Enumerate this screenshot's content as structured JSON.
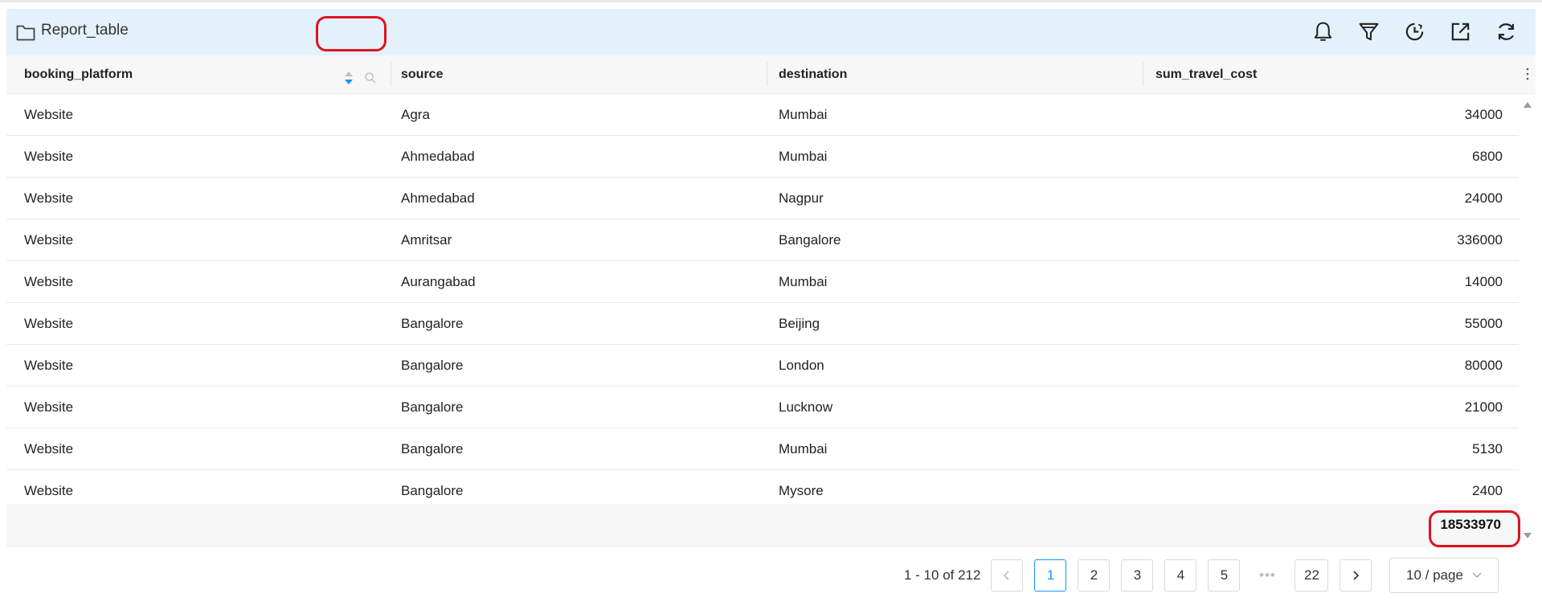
{
  "title": "Report_table",
  "toolbar_icons": [
    "bell-icon",
    "filter-icon",
    "clock-icon",
    "export-icon",
    "refresh-icon"
  ],
  "columns": [
    "booking_platform",
    "source",
    "destination",
    "sum_travel_cost"
  ],
  "rows": [
    [
      "Website",
      "Agra",
      "Mumbai",
      "34000"
    ],
    [
      "Website",
      "Ahmedabad",
      "Mumbai",
      "6800"
    ],
    [
      "Website",
      "Ahmedabad",
      "Nagpur",
      "24000"
    ],
    [
      "Website",
      "Amritsar",
      "Bangalore",
      "336000"
    ],
    [
      "Website",
      "Aurangabad",
      "Mumbai",
      "14000"
    ],
    [
      "Website",
      "Bangalore",
      "Beijing",
      "55000"
    ],
    [
      "Website",
      "Bangalore",
      "London",
      "80000"
    ],
    [
      "Website",
      "Bangalore",
      "Lucknow",
      "21000"
    ],
    [
      "Website",
      "Bangalore",
      "Mumbai",
      "5130"
    ],
    [
      "Website",
      "Bangalore",
      "Mysore",
      "2400"
    ]
  ],
  "summary_total": "18533970",
  "pagination": {
    "range_text": "1 - 10 of 212",
    "pages": [
      "1",
      "2",
      "3",
      "4",
      "5"
    ],
    "ellipsis": "•••",
    "last_page": "22",
    "page_size": "10 / page"
  },
  "colors": {
    "accent": "#1890ff",
    "highlight": "#e0131d",
    "title_bar": "#e3f1fb"
  }
}
